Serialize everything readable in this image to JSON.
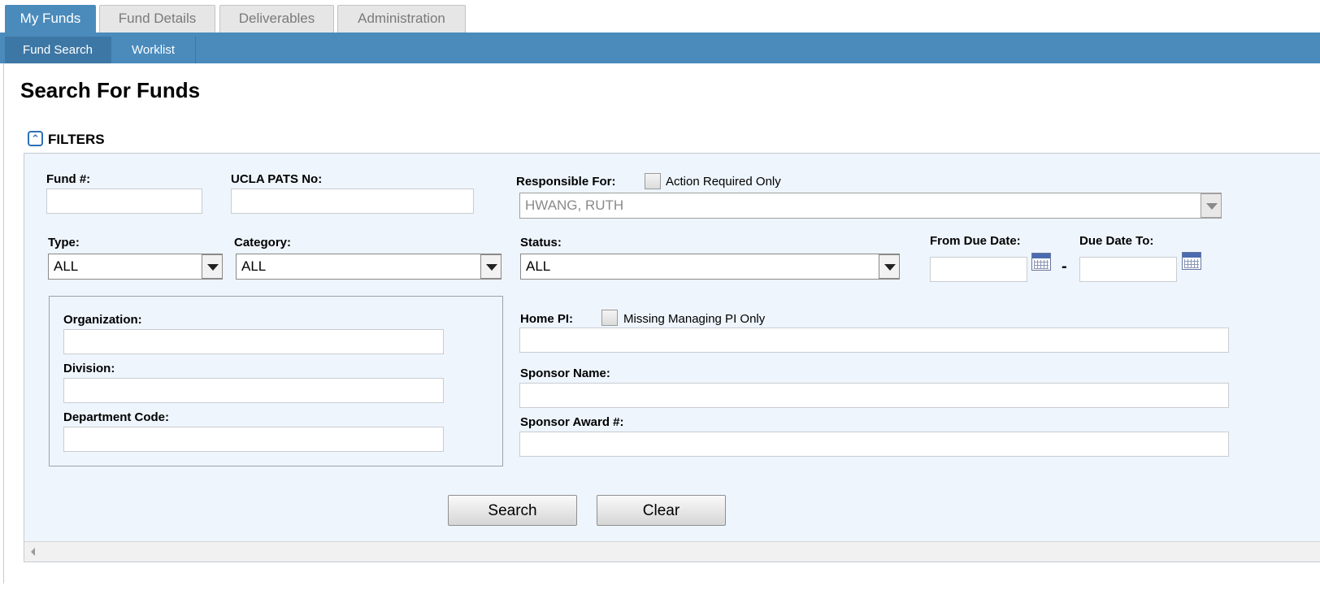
{
  "tabs": [
    {
      "label": "My Funds",
      "active": true
    },
    {
      "label": "Fund Details",
      "active": false
    },
    {
      "label": "Deliverables",
      "active": false
    },
    {
      "label": "Administration",
      "active": false
    }
  ],
  "subtabs": [
    {
      "label": "Fund Search",
      "active": true
    },
    {
      "label": "Worklist",
      "active": false
    }
  ],
  "page": {
    "title": "Search For Funds"
  },
  "filters": {
    "label": "FILTERS",
    "icon": "collapse-up-icon",
    "fund_no": {
      "label": "Fund #:",
      "value": ""
    },
    "pats_no": {
      "label": "UCLA PATS No:",
      "value": ""
    },
    "responsible": {
      "label": "Responsible For:",
      "action_required_label": "Action Required Only",
      "action_required_checked": false,
      "value": "HWANG, RUTH"
    },
    "type": {
      "label": "Type:",
      "value": "ALL"
    },
    "category": {
      "label": "Category:",
      "value": "ALL"
    },
    "status": {
      "label": "Status:",
      "value": "ALL"
    },
    "from_due_date": {
      "label": "From Due Date:",
      "value": ""
    },
    "due_date_to": {
      "label": "Due Date To:",
      "value": ""
    },
    "date_separator": "-",
    "organization": {
      "label": "Organization:",
      "value": ""
    },
    "division": {
      "label": "Division:",
      "value": ""
    },
    "department_code": {
      "label": "Department Code:",
      "value": ""
    },
    "home_pi": {
      "label": "Home PI:",
      "missing_label": "Missing Managing PI Only",
      "missing_checked": false,
      "value": ""
    },
    "sponsor_name": {
      "label": "Sponsor Name:",
      "value": ""
    },
    "sponsor_award": {
      "label": "Sponsor Award #:",
      "value": ""
    }
  },
  "buttons": {
    "search": "Search",
    "clear": "Clear"
  },
  "colors": {
    "nav_blue": "#4a8bbc",
    "panel_bg": "#eef5fc",
    "icon_blue": "#2e6fb8"
  }
}
